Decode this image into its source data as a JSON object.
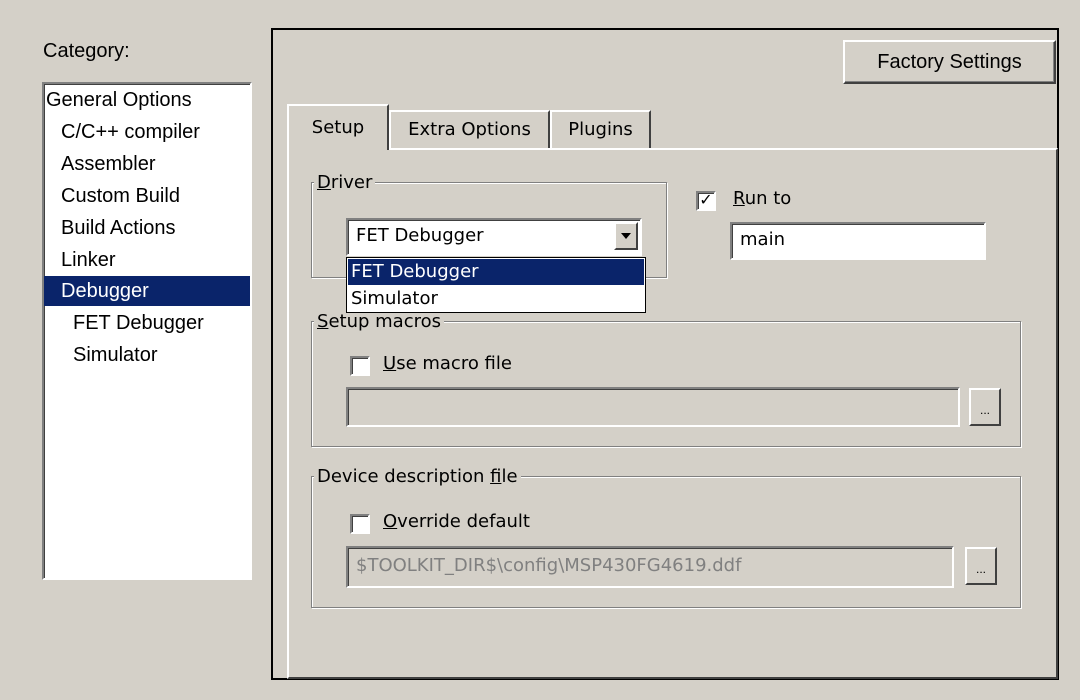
{
  "category": {
    "label": "Category:",
    "items": [
      {
        "label": "General Options"
      },
      {
        "label": "C/C++ compiler"
      },
      {
        "label": "Assembler"
      },
      {
        "label": "Custom Build"
      },
      {
        "label": "Build Actions"
      },
      {
        "label": "Linker"
      },
      {
        "label": "Debugger",
        "selected": true
      },
      {
        "label": "FET Debugger"
      },
      {
        "label": "Simulator"
      }
    ]
  },
  "factory_settings_label": "Factory Settings",
  "tabs": [
    {
      "label": "Setup",
      "active": true
    },
    {
      "label": "Extra Options"
    },
    {
      "label": "Plugins"
    }
  ],
  "driver": {
    "group_title_first": "D",
    "group_title_rest": "river",
    "selected": "FET Debugger",
    "options": [
      "FET Debugger",
      "Simulator"
    ]
  },
  "run_to": {
    "checked": true,
    "check_mark": "✓",
    "label_first": "R",
    "label_rest": "un to",
    "value": "main"
  },
  "setup_macros": {
    "title_first": "S",
    "title_rest": "etup macros",
    "checkbox_first": "U",
    "checkbox_rest": "se macro file",
    "checked": false,
    "path": "",
    "browse_label": "..."
  },
  "device_description": {
    "title_pre": "Device description ",
    "title_ul": "f",
    "title_post": "ile",
    "checkbox_first": "O",
    "checkbox_rest": "verride default",
    "checked": false,
    "path": "$TOOLKIT_DIR$\\config\\MSP430FG4619.ddf",
    "browse_label": "..."
  },
  "colors": {
    "selection": "#0a246a",
    "dialog_bg": "#d4d0c8"
  }
}
